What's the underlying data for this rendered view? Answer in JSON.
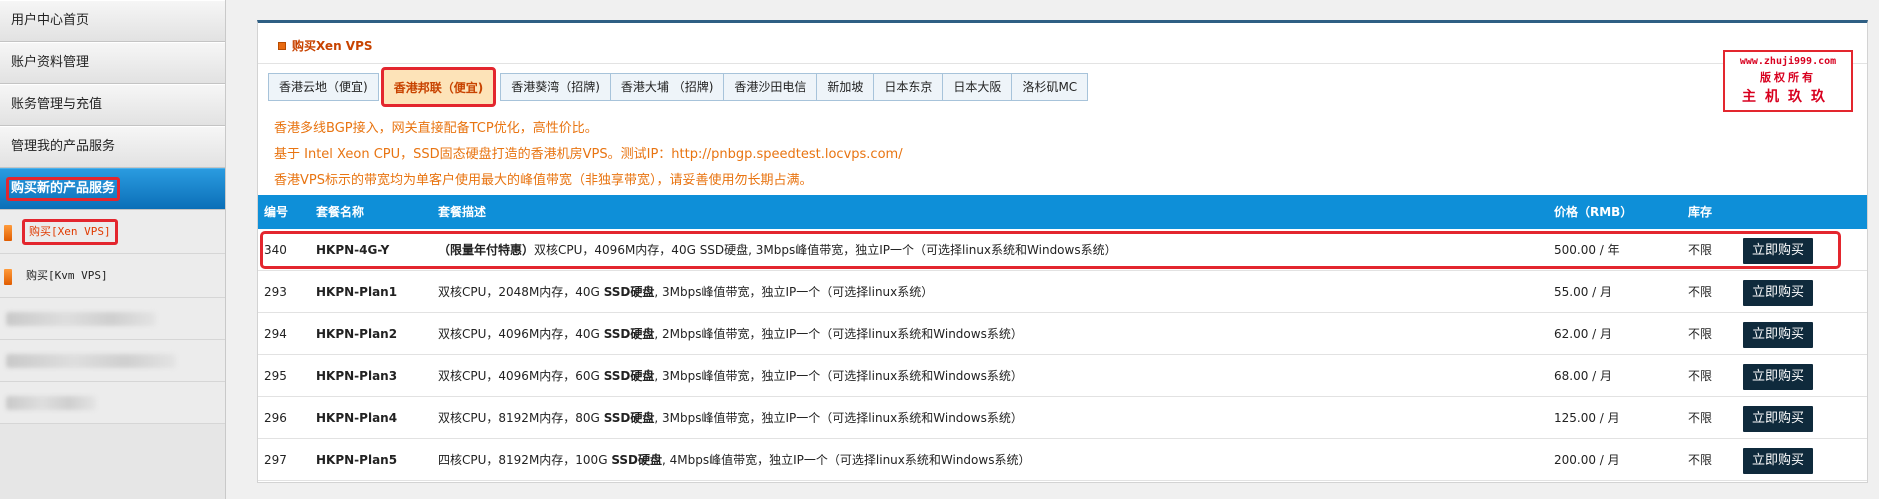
{
  "sidebar": {
    "items": [
      {
        "label": "用户中心首页"
      },
      {
        "label": "账户资料管理"
      },
      {
        "label": "账务管理与充值"
      },
      {
        "label": "管理我的产品服务"
      },
      {
        "label": "购买新的产品服务"
      }
    ],
    "subitems": [
      {
        "label": "购买[Xen VPS]"
      },
      {
        "label": "购买[Kvm VPS]"
      }
    ]
  },
  "panel": {
    "title": "购买Xen VPS",
    "tabs": [
      {
        "label": "香港云地（便宜)"
      },
      {
        "label": "香港邦联（便宜)"
      },
      {
        "label": "香港葵湾（招牌)"
      },
      {
        "label": "香港大埔 （招牌)"
      },
      {
        "label": "香港沙田电信"
      },
      {
        "label": "新加坡"
      },
      {
        "label": "日本东京"
      },
      {
        "label": "日本大阪"
      },
      {
        "label": "洛杉矶MC"
      }
    ],
    "notes": [
      "香港多线BGP接入，网关直接配备TCP优化，高性价比。",
      "基于 Intel Xeon CPU，SSD固态硬盘打造的香港机房VPS。测试IP：http://pnbgp.speedtest.locvps.com/",
      "香港VPS标示的带宽均为单客户使用最大的峰值带宽（非独享带宽），请妥善使用勿长期占满。"
    ]
  },
  "watermark": {
    "line1": "www.zhuji999.com",
    "line2": "版权所有",
    "line3": "主机玖玖"
  },
  "table": {
    "headers": {
      "id": "编号",
      "name": "套餐名称",
      "desc": "套餐描述",
      "price": "价格（RMB）",
      "stock": "库存"
    },
    "buy_label": "立即购买",
    "rows": [
      {
        "id": "340",
        "name": "HKPN-4G-Y",
        "prefix": "（限量年付特惠）",
        "desc_a": "双核CPU，4096M内存，40G SSD硬盘, 3Mbps峰值带宽，独立IP一个（可选择linux系统和Windows系统）",
        "ssd": "",
        "desc_b": "",
        "price": "500.00 / 年",
        "stock": "不限"
      },
      {
        "id": "293",
        "name": "HKPN-Plan1",
        "prefix": "",
        "desc_a": "双核CPU，2048M内存，40G ",
        "ssd": "SSD硬盘",
        "desc_b": ", 3Mbps峰值带宽，独立IP一个（可选择linux系统）",
        "price": "55.00 / 月",
        "stock": "不限"
      },
      {
        "id": "294",
        "name": "HKPN-Plan2",
        "prefix": "",
        "desc_a": "双核CPU，4096M内存，40G ",
        "ssd": "SSD硬盘",
        "desc_b": ", 2Mbps峰值带宽，独立IP一个（可选择linux系统和Windows系统）",
        "price": "62.00 / 月",
        "stock": "不限"
      },
      {
        "id": "295",
        "name": "HKPN-Plan3",
        "prefix": "",
        "desc_a": "双核CPU，4096M内存，60G ",
        "ssd": "SSD硬盘",
        "desc_b": ", 3Mbps峰值带宽，独立IP一个（可选择linux系统和Windows系统）",
        "price": "68.00 / 月",
        "stock": "不限"
      },
      {
        "id": "296",
        "name": "HKPN-Plan4",
        "prefix": "",
        "desc_a": "双核CPU，8192M内存，80G ",
        "ssd": "SSD硬盘",
        "desc_b": ", 3Mbps峰值带宽，独立IP一个（可选择linux系统和Windows系统）",
        "price": "125.00 / 月",
        "stock": "不限"
      },
      {
        "id": "297",
        "name": "HKPN-Plan5",
        "prefix": "",
        "desc_a": "四核CPU，8192M内存，100G ",
        "ssd": "SSD硬盘",
        "desc_b": ", 4Mbps峰值带宽，独立IP一个（可选择linux系统和Windows系统）",
        "price": "200.00 / 月",
        "stock": "不限"
      }
    ]
  },
  "colors": {
    "accent_blue": "#0e8fd8",
    "highlight_red": "#e3262e",
    "note_orange": "#e87411",
    "button_dark": "#0f2a3c"
  }
}
